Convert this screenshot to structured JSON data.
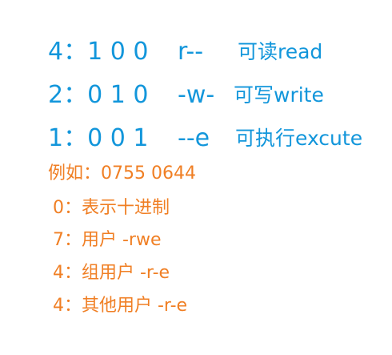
{
  "permissions": [
    {
      "code": "4：1 0 0",
      "symbol": "r--",
      "desc": "可读read"
    },
    {
      "code": "2：0 1 0",
      "symbol": "-w-",
      "desc": "可写write"
    },
    {
      "code": "1：0 0 1",
      "symbol": "--e",
      "desc": "可执行excute"
    }
  ],
  "example": "例如：0755 0644",
  "notes": [
    "0：表示十进制",
    "7：用户 -rwe",
    "4：组用户 -r-e",
    "4：其他用户 -r-e"
  ],
  "colors": {
    "blue": "#1296db",
    "orange": "#f07f24"
  }
}
